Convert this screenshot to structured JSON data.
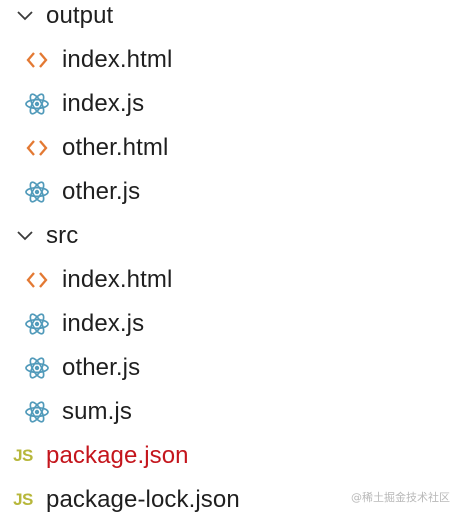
{
  "explorer": {
    "output": {
      "name": "output",
      "expanded": true,
      "files": [
        {
          "name": "index.html",
          "icon": "html-file-icon"
        },
        {
          "name": "index.js",
          "icon": "react-file-icon"
        },
        {
          "name": "other.html",
          "icon": "html-file-icon"
        },
        {
          "name": "other.js",
          "icon": "react-file-icon"
        }
      ]
    },
    "src": {
      "name": "src",
      "expanded": true,
      "files": [
        {
          "name": "index.html",
          "icon": "html-file-icon"
        },
        {
          "name": "index.js",
          "icon": "react-file-icon"
        },
        {
          "name": "other.js",
          "icon": "react-file-icon"
        },
        {
          "name": "sum.js",
          "icon": "react-file-icon"
        }
      ]
    },
    "root_files": [
      {
        "name": "package.json",
        "icon_text": "JS",
        "status": "modified"
      },
      {
        "name": "package-lock.json",
        "icon_text": "JS",
        "status": "normal"
      }
    ]
  },
  "colors": {
    "html_icon": "#e37933",
    "react_icon": "#519aba",
    "json_icon": "#b7b73b",
    "modified_text": "#c4151c",
    "text": "#1f1f1f"
  },
  "watermark": "@稀土掘金技术社区"
}
